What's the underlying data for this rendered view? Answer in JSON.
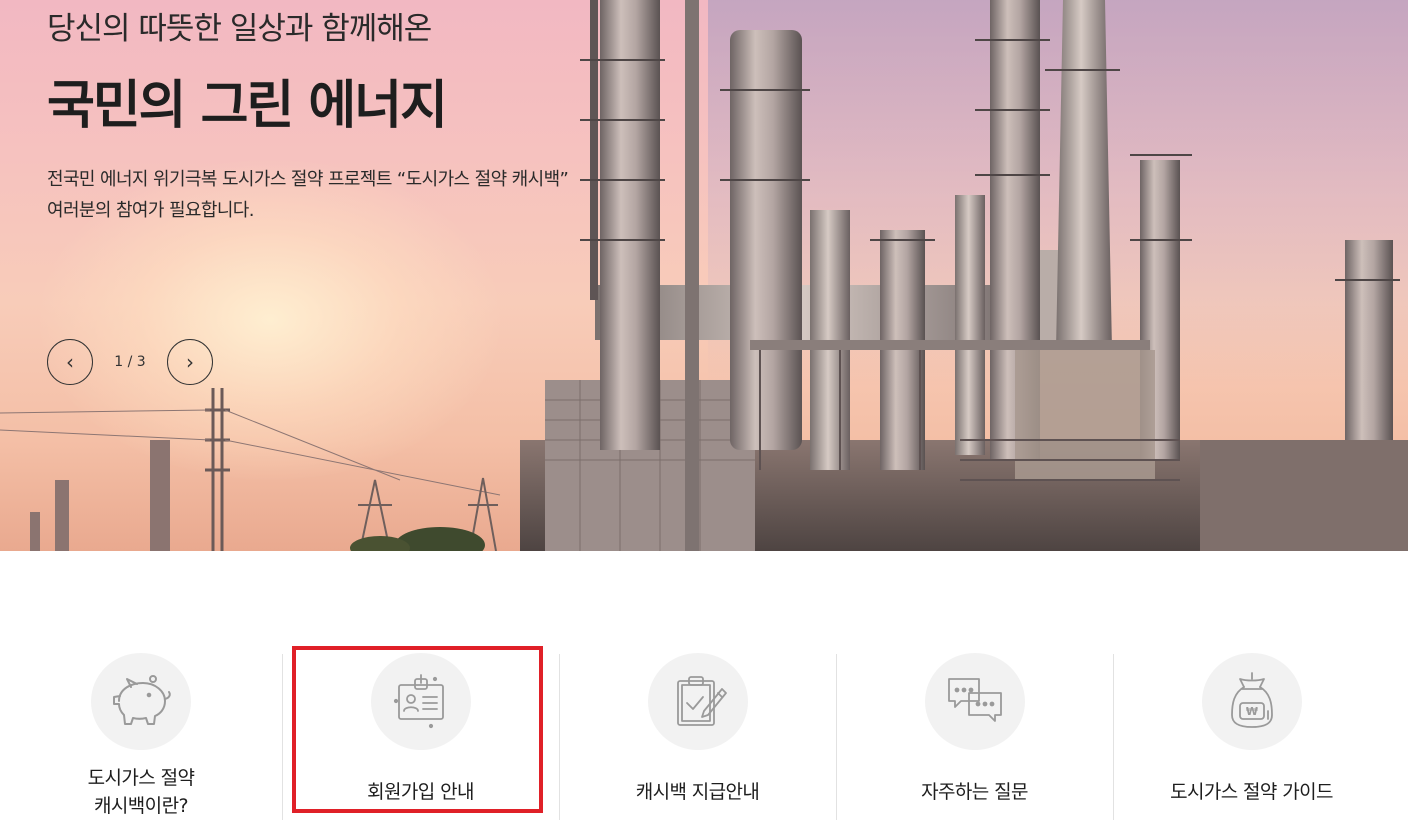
{
  "hero": {
    "subtitle": "당신의 따뜻한 일상과 함께해온",
    "title": "국민의 그린 에너지",
    "description": "전국민 에너지 위기극복 도시가스 절약 프로젝트 “도시가스 절약 캐시백”\n여러분의 참여가 필요합니다.",
    "slider": {
      "prev_icon": "‹",
      "next_icon": "›",
      "page_indicator": "1 / 3"
    }
  },
  "menu": {
    "items": [
      {
        "label": "도시가스 절약\n캐시백이란?",
        "icon": "piggy-bank-icon"
      },
      {
        "label": "회원가입 안내",
        "icon": "id-card-icon",
        "highlighted": true
      },
      {
        "label": "캐시백 지급안내",
        "icon": "clipboard-check-icon"
      },
      {
        "label": "자주하는 질문",
        "icon": "chat-bubbles-icon"
      },
      {
        "label": "도시가스 절약 가이드",
        "icon": "money-bag-icon"
      }
    ]
  },
  "colors": {
    "highlight": "#e02028",
    "icon_bg": "#f2f2f2",
    "icon_stroke": "#9a9a9a"
  }
}
